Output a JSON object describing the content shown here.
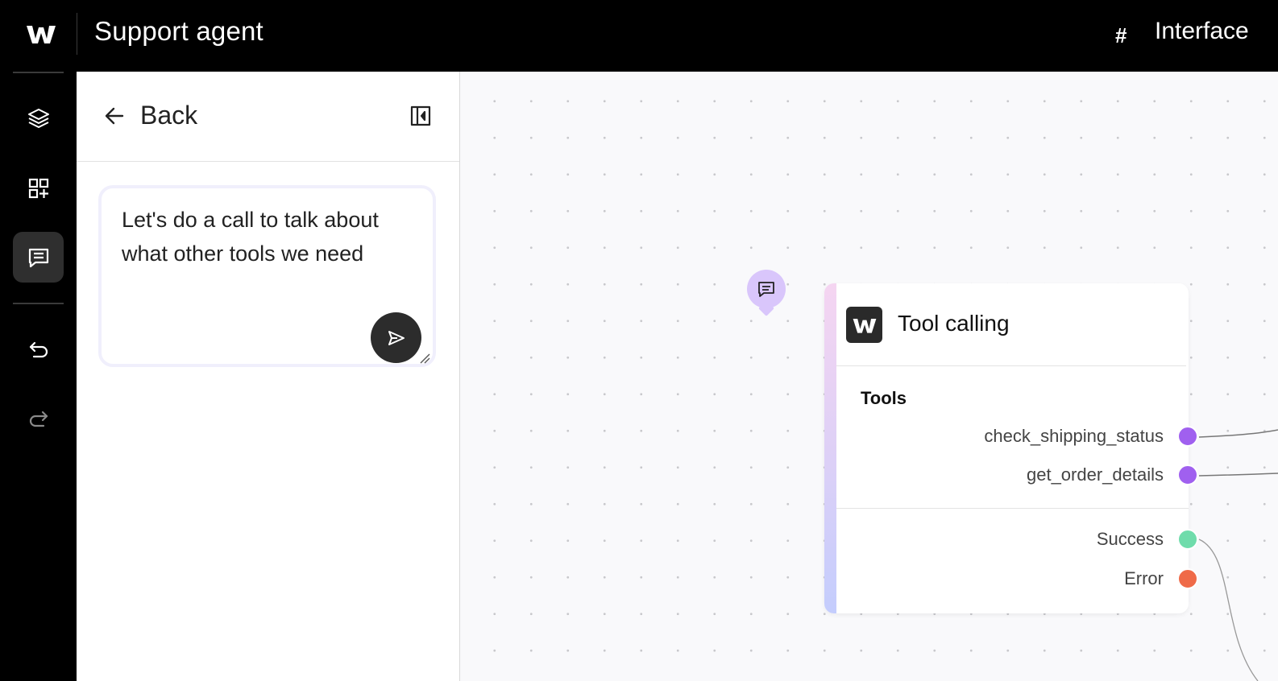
{
  "header": {
    "app_title": "Support agent",
    "right_tab_icon": "hash-icon",
    "right_tab_label": "Interface"
  },
  "rail": {
    "items": [
      {
        "name": "layers-icon"
      },
      {
        "name": "add-widget-icon"
      },
      {
        "name": "chat-icon",
        "active": true
      },
      {
        "name": "undo-icon"
      },
      {
        "name": "redo-icon"
      }
    ]
  },
  "panel": {
    "back_label": "Back",
    "chat_input_value": "Let's do a call to talk about what other tools we need"
  },
  "node": {
    "title": "Tool calling",
    "section_label": "Tools",
    "tools": [
      "check_shipping_status",
      "get_order_details"
    ],
    "outputs": [
      {
        "label": "Success",
        "color": "#6fdcab"
      },
      {
        "label": "Error",
        "color": "#ef6a48"
      }
    ],
    "tool_port_color": "#a060ef",
    "accent_gradient": [
      "#f5d5f1",
      "#c4cdfd"
    ]
  },
  "comment_pin_color": "#d9c6fb"
}
